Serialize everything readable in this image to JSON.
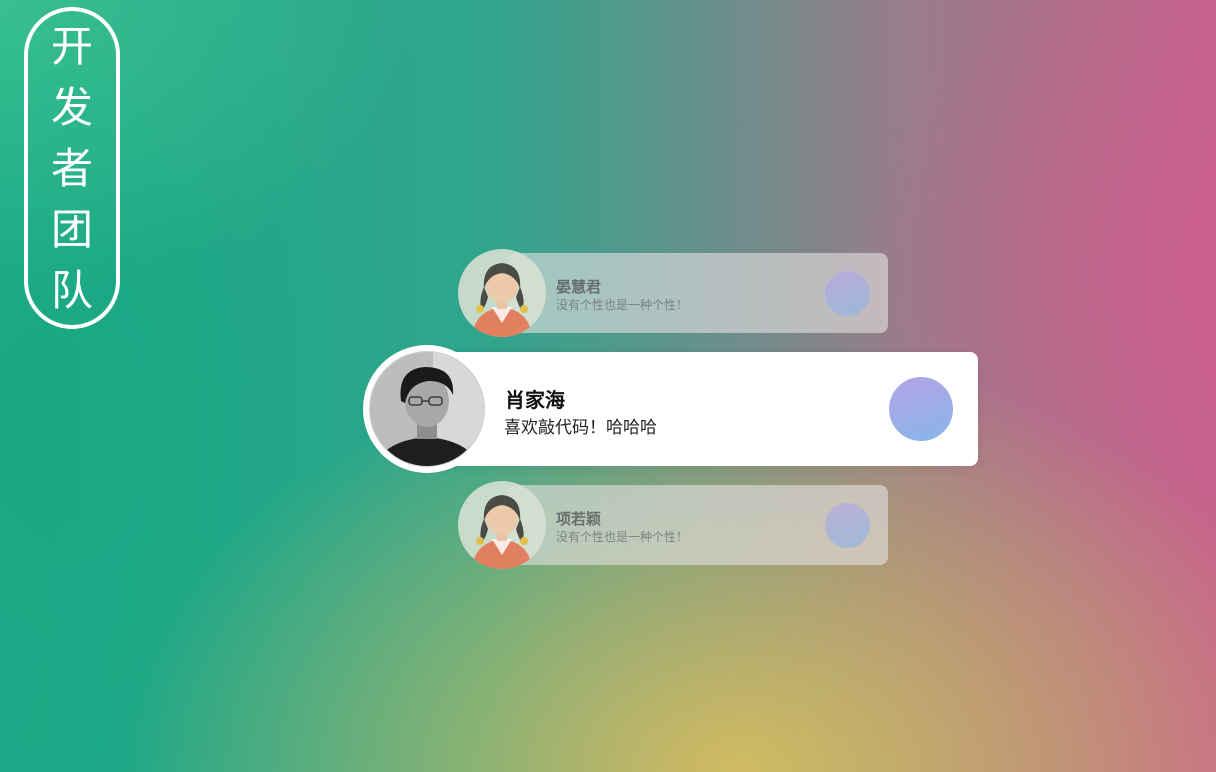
{
  "team_title": [
    "开",
    "发",
    "者",
    "团",
    "队"
  ],
  "members": [
    {
      "name": "晏慧君",
      "motto": "没有个性也是一种个性！",
      "avatar_icon": "girl-cartoon-avatar",
      "state": "dim"
    },
    {
      "name": "肖家海",
      "motto": "喜欢敲代码！哈哈哈",
      "avatar_icon": "person-photo-avatar",
      "state": "active"
    },
    {
      "name": "项若颖",
      "motto": "没有个性也是一种个性！",
      "avatar_icon": "girl-cartoon-avatar",
      "state": "dim"
    }
  ],
  "colors": {
    "background_green": "#1aa988",
    "background_pink": "#c5628c",
    "background_yellow": "#d6be5f",
    "dot_gradient_start": "#b6a3e6",
    "dot_gradient_end": "#86b6e8",
    "card_active": "#ffffff"
  }
}
